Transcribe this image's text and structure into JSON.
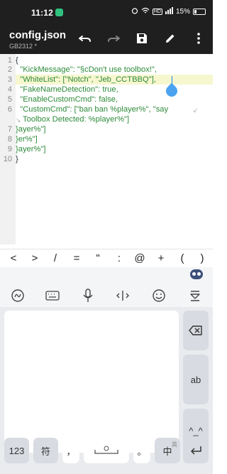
{
  "status_bar": {
    "time": "11:12",
    "network": "HD",
    "battery": "15%"
  },
  "toolbar": {
    "file_name": "config.json",
    "encoding": "GB2312 *"
  },
  "editor": {
    "line_numbers": [
      "1",
      "2",
      "3",
      "4",
      "5",
      "6",
      "7",
      "8",
      "9",
      "10"
    ],
    "lines": [
      "{",
      "  \"KickMessage\": \"§cDon't use toolbox!\",",
      "  \"WhiteList\": [\"Notch\", \"Jeb_CCTBBQ\"],",
      "  \"FakeNameDetection\": true,",
      "  \"EnableCustomCmd\": false,",
      "  \"CustomCmd\": [\"ban ban %player%\", \"say",
      "Toolbox Detected: %player%\"]",
      "}ayer%\"]",
      "}er%\"]",
      "}ayer%\"]",
      "}"
    ]
  },
  "symbol_bar": [
    "<",
    ">",
    "/",
    "=",
    "\"",
    ":",
    "@",
    "+",
    "(",
    ")"
  ],
  "keyboard": {
    "key_123": "123",
    "key_fu": "符",
    "key_comma": "，",
    "key_period": "。",
    "key_zh": "中",
    "key_zh_sub": "英",
    "key_ab": "ab",
    "key_face": "^_^"
  },
  "colors": {
    "toolbar_bg": "#1f1f1f",
    "syntax_green": "#2e8b3a",
    "cursor_blue": "#4ba3f0"
  }
}
